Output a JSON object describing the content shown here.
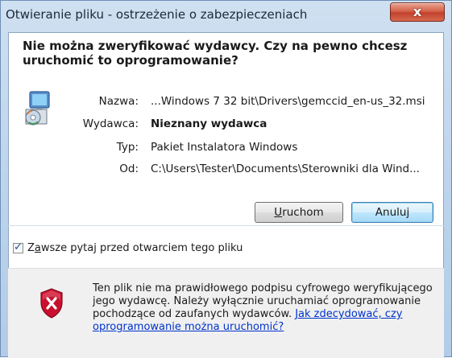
{
  "window": {
    "title": "Otwieranie pliku - ostrzeżenie o zabezpieczeniach",
    "close_label": "x"
  },
  "header": {
    "line1": "Nie można zweryfikować wydawcy. Czy na pewno chcesz",
    "line2": "uruchomić to oprogramowanie?"
  },
  "details": [
    {
      "label": "Nazwa:",
      "value": "...Windows 7 32 bit\\Drivers\\gemccid_en-us_32.msi"
    },
    {
      "label": "Wydawca:",
      "value": "Nieznany wydawca"
    },
    {
      "label": "Typ:",
      "value": "Pakiet Instalatora Windows"
    },
    {
      "label": "Od:",
      "value": "C:\\Users\\Tester\\Documents\\Sterowniki dla Wind..."
    }
  ],
  "buttons": {
    "run_prefix": "U",
    "run_rest": "ruchom",
    "cancel": "Anuluj"
  },
  "checkbox": {
    "checked": true,
    "label_prefix": "Z",
    "label_accel": "a",
    "label_rest": "wsze pytaj przed otwarciem tego pliku"
  },
  "footer": {
    "message": "Ten plik nie ma prawidłowego podpisu cyfrowego weryfikującego jego wydawcę. Należy wyłącznie uruchamiać oprogramowanie pochodzące od zaufanych wydawców. ",
    "link": "Jak zdecydować, czy oprogramowanie można uruchomić?"
  },
  "icons": {
    "titlebar_close": "close-icon",
    "installer": "installer-package-icon",
    "warning": "security-shield-icon"
  },
  "colors": {
    "title_bg": "#bcd3ec",
    "close_red": "#c1412c",
    "link": "#0033cc",
    "shield_red": "#c8102e"
  }
}
